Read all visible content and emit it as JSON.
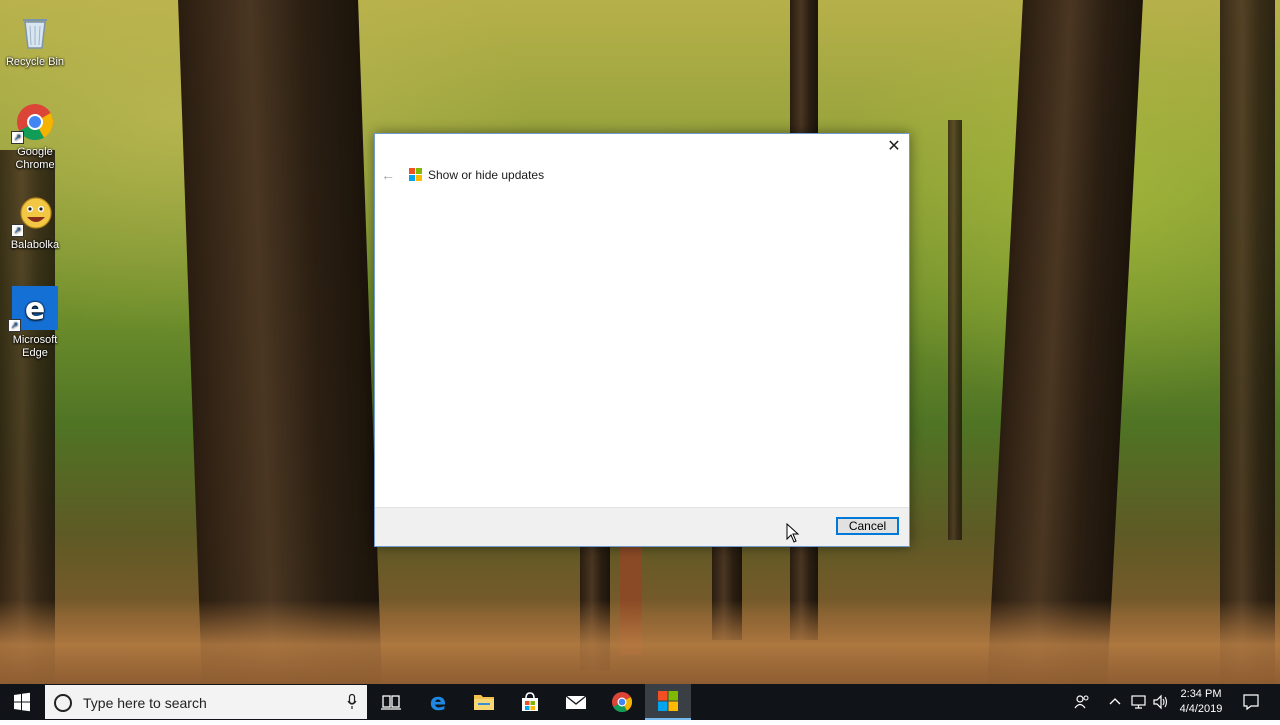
{
  "desktop": {
    "icons": [
      {
        "label": "Recycle Bin",
        "icon": "recycle-bin-icon"
      },
      {
        "label": "Google Chrome",
        "icon": "chrome-icon"
      },
      {
        "label": "Balabolka",
        "icon": "balabolka-icon"
      },
      {
        "label": "Microsoft Edge",
        "icon": "edge-icon"
      }
    ]
  },
  "dialog": {
    "title": "Show or hide updates",
    "close_label": "✕",
    "back_label": "←",
    "cancel_label": "Cancel"
  },
  "taskbar": {
    "search_placeholder": "Type here to search",
    "pinned": [
      "task-view-icon",
      "edge-icon",
      "file-explorer-icon",
      "store-icon",
      "mail-icon",
      "chrome-icon",
      "update-troubleshooter-icon"
    ],
    "active_app": "update-troubleshooter-icon",
    "clock": {
      "time": "2:34 PM",
      "date": "4/4/2019"
    },
    "tray_icons": [
      "people-icon",
      "chevron-up-icon",
      "network-icon",
      "volume-icon",
      "action-center-icon"
    ]
  },
  "colors": {
    "accent": "#0078d7",
    "taskbar": "#101418",
    "ms_red": "#f25022",
    "ms_green": "#7fba00",
    "ms_blue": "#00a4ef",
    "ms_yellow": "#ffb900"
  }
}
